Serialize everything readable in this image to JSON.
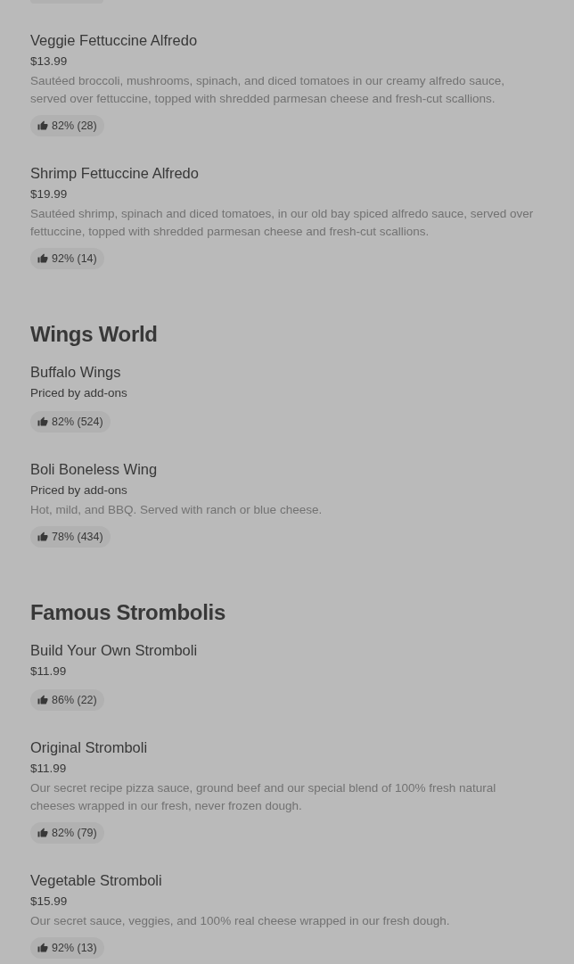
{
  "sections": [
    {
      "items": [
        {
          "name": "Veggie Fettuccine Alfredo",
          "price": "$13.99",
          "description": "Sautéed broccoli, mushrooms, spinach, and diced tomatoes in our creamy alfredo sauce, served over fettuccine, topped with shredded parmesan cheese and fresh-cut scallions.",
          "rating": "82% (28)"
        },
        {
          "name": "Shrimp Fettuccine Alfredo",
          "price": "$19.99",
          "description": "Sautéed shrimp, spinach and diced tomatoes, in our old bay spiced alfredo sauce, served over fettuccine, topped with shredded parmesan cheese and fresh-cut scallions.",
          "rating": "92% (14)"
        }
      ]
    },
    {
      "title": "Wings World",
      "items": [
        {
          "name": "Buffalo Wings",
          "price": "Priced by add-ons",
          "rating": "82% (524)"
        },
        {
          "name": "Boli Boneless Wing",
          "price": "Priced by add-ons",
          "description": "Hot, mild, and BBQ. Served with ranch or blue cheese.",
          "rating": "78% (434)"
        }
      ]
    },
    {
      "title": "Famous Strombolis",
      "items": [
        {
          "name": "Build Your Own Stromboli",
          "price": "$11.99",
          "rating": "86% (22)"
        },
        {
          "name": "Original Stromboli",
          "price": "$11.99",
          "description": "Our secret recipe pizza sauce, ground beef and our special blend of 100% fresh natural cheeses wrapped in our fresh, never frozen dough.",
          "rating": "82% (79)"
        },
        {
          "name": "Vegetable Stromboli",
          "price": "$15.99",
          "description": "Our secret sauce, veggies, and 100% real cheese wrapped in our fresh dough.",
          "rating": "92% (13)"
        }
      ]
    }
  ]
}
